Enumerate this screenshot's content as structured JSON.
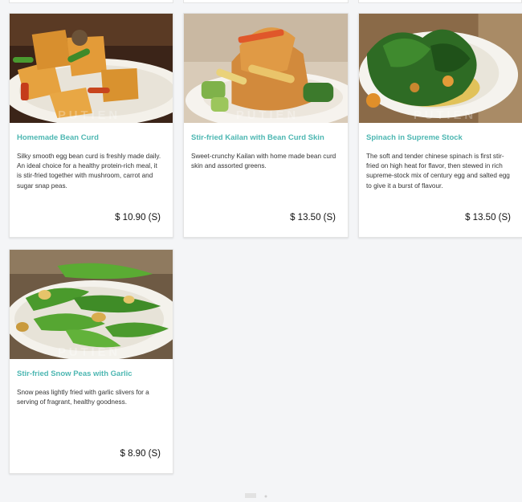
{
  "colors": {
    "title_accent": "#4db7b2",
    "page_bg": "#f4f5f7"
  },
  "watermark_text": "PUTIEN",
  "menu_items": [
    {
      "name": "Homemade Bean Curd",
      "description": "Silky smooth egg bean curd is freshly made daily. An ideal choice for a healthy protein-rich meal, it is stir-fried together with mushroom, carrot and sugar snap peas.",
      "price": "$ 10.90 (S)"
    },
    {
      "name": "Stir-fried Kailan with Bean Curd Skin",
      "description": "Sweet-crunchy Kailan with home made bean curd skin and assorted greens.",
      "price": "$ 13.50 (S)"
    },
    {
      "name": "Spinach in Supreme Stock",
      "description": "The soft and tender chinese spinach is first stir-fried on high heat for flavor, then stewed in rich supreme-stock mix of century egg and salted egg to give it a burst of flavour.",
      "price": "$ 13.50 (S)"
    },
    {
      "name": "Stir-fried Snow Peas with Garlic",
      "description": "Snow peas lightly fried with garlic slivers for a serving of fragrant, healthy goodness.",
      "price": "$ 8.90 (S)"
    }
  ]
}
